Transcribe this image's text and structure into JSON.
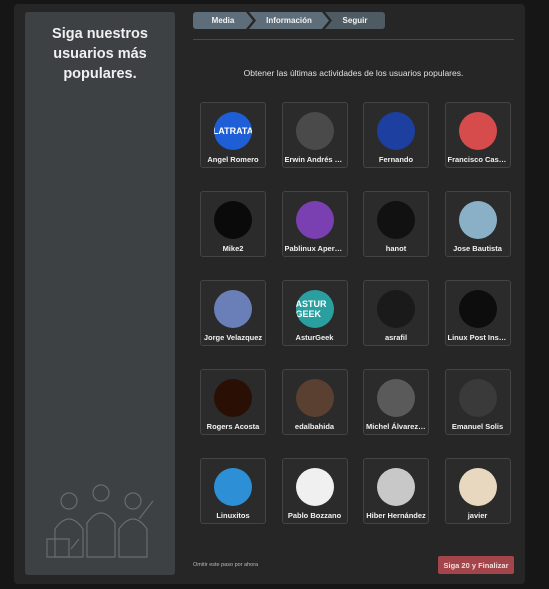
{
  "sidebar": {
    "title": "Siga nuestros usuarios más populares."
  },
  "steps": [
    {
      "label": "Media"
    },
    {
      "label": "Información"
    },
    {
      "label": "Seguir"
    }
  ],
  "subtitle": "Obtener las últimas actividades de los usuarios populares.",
  "users": [
    {
      "name": "Angel Romero",
      "avatar_bg": "#1e5fd8",
      "avatar_text": "LATRATA"
    },
    {
      "name": "Erwin Andrés E...",
      "avatar_bg": "#4a4a4a",
      "avatar_text": ""
    },
    {
      "name": "Fernando",
      "avatar_bg": "#1d3fa0",
      "avatar_text": ""
    },
    {
      "name": "Francisco Cast...",
      "avatar_bg": "#d64b4b",
      "avatar_text": ""
    },
    {
      "name": "Mike2",
      "avatar_bg": "#0a0a0a",
      "avatar_text": ""
    },
    {
      "name": "Pablinux Aperri...",
      "avatar_bg": "#7a3fb0",
      "avatar_text": ""
    },
    {
      "name": "hanot",
      "avatar_bg": "#111111",
      "avatar_text": ""
    },
    {
      "name": "Jose Bautista",
      "avatar_bg": "#8ab0c8",
      "avatar_text": ""
    },
    {
      "name": "Jorge Velazquez",
      "avatar_bg": "#6a7fb8",
      "avatar_text": ""
    },
    {
      "name": "AsturGeek",
      "avatar_bg": "#2a9fa0",
      "avatar_text": "ASTUR GEEK"
    },
    {
      "name": "asrafil",
      "avatar_bg": "#1a1a1a",
      "avatar_text": ""
    },
    {
      "name": "Linux Post Install",
      "avatar_bg": "#0d0d0d",
      "avatar_text": ""
    },
    {
      "name": "Rogers Acosta",
      "avatar_bg": "#2a0f05",
      "avatar_text": ""
    },
    {
      "name": "edalbahida",
      "avatar_bg": "#5a4030",
      "avatar_text": ""
    },
    {
      "name": "Michel Álvarez ...",
      "avatar_bg": "#5a5a5a",
      "avatar_text": ""
    },
    {
      "name": "Emanuel Solis",
      "avatar_bg": "#3a3a3a",
      "avatar_text": ""
    },
    {
      "name": "Linuxitos",
      "avatar_bg": "#2d8fd6",
      "avatar_text": ""
    },
    {
      "name": "Pablo Bozzano",
      "avatar_bg": "#f0f0f0",
      "avatar_text": ""
    },
    {
      "name": "Hiber Hernández",
      "avatar_bg": "#c8c8c8",
      "avatar_text": ""
    },
    {
      "name": "javier",
      "avatar_bg": "#e8d8c0",
      "avatar_text": ""
    }
  ],
  "footer": {
    "skip_label": "Omitir este paso por ahora",
    "finish_label": "Siga 20 y Finalizar"
  }
}
